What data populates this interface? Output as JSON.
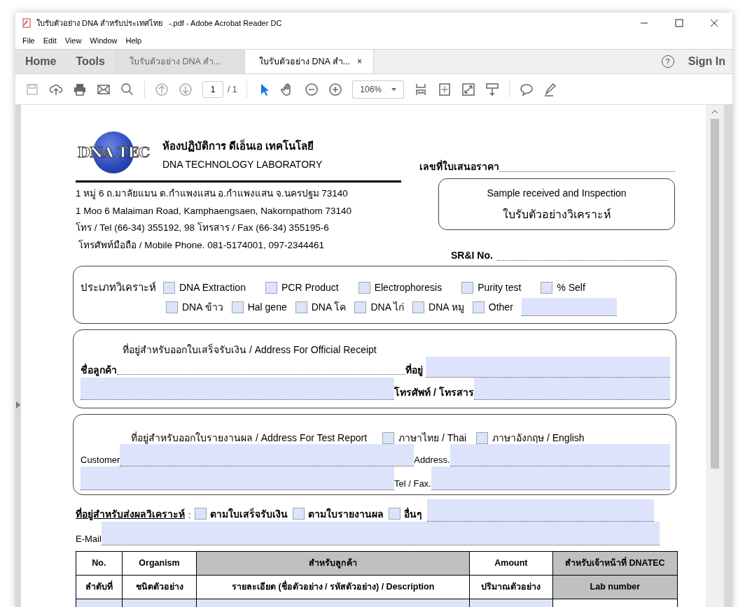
{
  "window": {
    "title": "ใบรับตัวอย่าง DNA สำหรับประเทศไทย   -.pdf - Adobe Acrobat Reader DC"
  },
  "menu": [
    "File",
    "Edit",
    "View",
    "Window",
    "Help"
  ],
  "tabs": [
    {
      "label": "Home",
      "kind": "nav",
      "selected": false
    },
    {
      "label": "Tools",
      "kind": "nav",
      "selected": false
    },
    {
      "label": "ใบรับตัวอย่าง DNA สำ...",
      "kind": "doc",
      "selected": false
    },
    {
      "label": "ใบรับตัวอย่าง DNA สำ...",
      "kind": "doc",
      "selected": true,
      "close": "×"
    }
  ],
  "help": "?",
  "sign_in": "Sign In",
  "toolbar": {
    "page": "1",
    "page_count": "/ 1",
    "zoom": "106%"
  },
  "form": {
    "logo_text": "DNA TEC",
    "lab_th": "ห้องปฏิบัติการ ดีเอ็นเอ เทคโนโลยี",
    "lab_en": "DNA TECHNOLOGY LABORATORY",
    "address": [
      "1 หมู่ 6 ถ.มาลัยแมน ต.กำแพงแสน อ.กำแพงแสน จ.นครปฐม 73140",
      "1 Moo 6 Malaiman Road, Kamphaengsaen, Nakornpathom 73140",
      "โทร / Tel (66-34) 355192, 98  โทรสาร / Fax (66-34) 355195-6",
      "โทรศัพท์มือถือ / Mobile Phone. 081-5174001, 097-2344461"
    ],
    "quote_no": "เลขที่ใบเสนอราคา",
    "title_en": "Sample received and Inspection",
    "title_th": "ใบรับตัวอย่างวิเคราะห์",
    "sr_no": "SR&I No.",
    "analysis_label": "ประเภทวิเคราะห์",
    "analysis_rows": [
      [
        {
          "label": "DNA Extraction",
          "checked": false
        },
        {
          "label": "PCR Product",
          "checked": false
        },
        {
          "label": "Electrophoresis",
          "checked": false
        },
        {
          "label": "Purity test",
          "checked": false
        },
        {
          "label": "% Self",
          "checked": false
        }
      ],
      [
        {
          "label": "DNA ข้าว",
          "checked": false
        },
        {
          "label": "Hal gene",
          "checked": false
        },
        {
          "label": "DNA โค",
          "checked": false
        },
        {
          "label": "DNA ไก่",
          "checked": false
        },
        {
          "label": "DNA หมู",
          "checked": false
        },
        {
          "label": "Other",
          "checked": false
        }
      ]
    ],
    "receipt": {
      "heading": "ที่อยู่สำหรับออกใบเสร็จรับเงิน / Address For Official Receipt",
      "name": "ชื่อลูกค้า",
      "address": "ที่อยู่",
      "phone": "โทรศัพท์ / โทรสาร"
    },
    "report": {
      "heading": "ที่อยู่สำหรับออกใบรายงานผล / Address For Test Report",
      "languages": [
        {
          "label": "ภาษาไทย / Thai",
          "checked": false
        },
        {
          "label": "ภาษาอังกฤษ / English",
          "checked": false
        }
      ],
      "customer": "Customer",
      "address": "Address.",
      "phone": "Tel / Fax."
    },
    "delivery": {
      "label": "ที่อยู่สำหรับส่งผลวิเคราะห์",
      "colon": ":",
      "options": [
        {
          "label": "ตามใบเสร็จรับเงิน",
          "checked": false
        },
        {
          "label": "ตามใบรายงานผล",
          "checked": false
        },
        {
          "label": "อื่นๆ",
          "checked": false
        }
      ],
      "email": "E-Mail"
    },
    "table": {
      "columns": [
        {
          "kind": "plain",
          "top": "No.",
          "bottom": "ลำดับที่"
        },
        {
          "kind": "plain",
          "top": "Organism",
          "bottom": "ชนิดตัวอย่าง"
        },
        {
          "kind": "group",
          "top": "สำหรับลูกค้า",
          "bottom": "รายละเอียด (ชื่อตัวอย่าง  / รหัสตัวอย่าง) / Description"
        },
        {
          "kind": "plain",
          "top": "Amount",
          "bottom": "ปริมาณตัวอย่าง"
        },
        {
          "kind": "staff",
          "top": "สำหรับเจ้าหน้าที่ DNATEC",
          "bottom": "Lab number"
        }
      ]
    }
  }
}
